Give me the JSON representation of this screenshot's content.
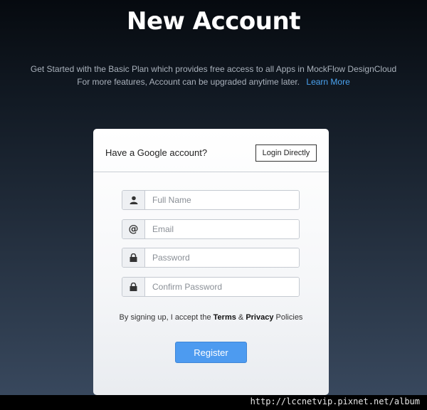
{
  "page": {
    "title": "New Account",
    "subtitle_line1": "Get Started with the Basic Plan which provides free access to all Apps in MockFlow DesignCloud",
    "subtitle_line2": "For more features, Account can be upgraded anytime later.",
    "learn_more": "Learn More"
  },
  "card": {
    "google_prompt": "Have a Google account?",
    "login_button": "Login Directly",
    "fields": [
      {
        "placeholder": "Full Name",
        "value": "",
        "icon": "person-icon"
      },
      {
        "placeholder": "Email",
        "value": "",
        "icon": "at-icon"
      },
      {
        "placeholder": "Password",
        "value": "",
        "icon": "lock-icon"
      },
      {
        "placeholder": "Confirm Password",
        "value": "",
        "icon": "lock-icon"
      }
    ],
    "agreement": {
      "prefix": "By signing up, I accept the",
      "terms": "Terms",
      "amp": "&",
      "privacy": "Privacy",
      "suffix": "Policies"
    },
    "register_button": "Register"
  },
  "watermark": "http://lccnetvip.pixnet.net/album",
  "colors": {
    "accent": "#4d9bf0",
    "link": "#4aa3f0"
  }
}
